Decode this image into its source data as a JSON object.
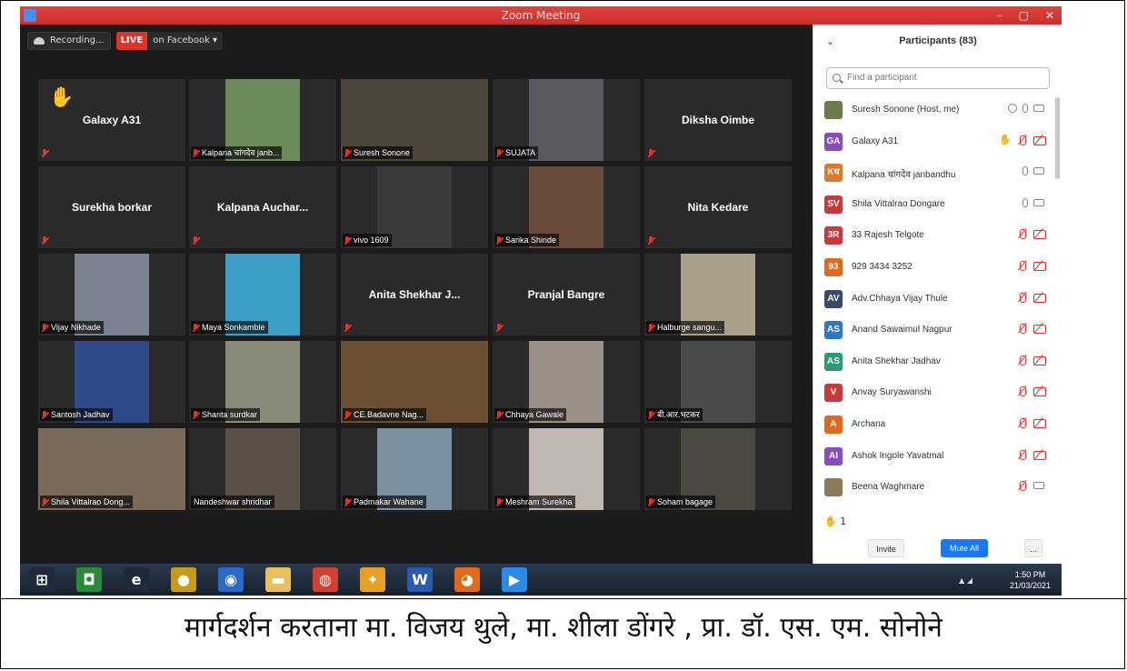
{
  "window": {
    "title": "Zoom Meeting",
    "controls": [
      "–",
      "▢",
      "✕"
    ]
  },
  "topbar": {
    "recording_label": "Recording...",
    "live_badge": "LIVE",
    "live_target": "on Facebook",
    "live_caret": "▾"
  },
  "tiles": [
    {
      "name": "Galaxy A31",
      "style": "center",
      "hand": true,
      "color": "#2a2a2a"
    },
    {
      "name": "Kalpana चांगदेव janb...",
      "style": "label",
      "color": "#6a8a5a"
    },
    {
      "name": "Suresh Sonone",
      "style": "label",
      "color": "#4b4438"
    },
    {
      "name": "SUJATA",
      "style": "label",
      "color": "#5a5a60"
    },
    {
      "name": "Diksha Oimbe",
      "style": "center",
      "color": "#2a2a2a"
    },
    {
      "name": "Surekha borkar",
      "style": "center",
      "color": "#2a2a2a"
    },
    {
      "name": "Kalpana  Auchar...",
      "style": "center",
      "color": "#2a2a2a"
    },
    {
      "name": "vivo 1609",
      "style": "label",
      "color": "#3d3a3a"
    },
    {
      "name": "Sarika Shinde",
      "style": "label",
      "color": "#6a4a3a"
    },
    {
      "name": "Nita Kedare",
      "style": "center",
      "color": "#2a2a2a"
    },
    {
      "name": "Vijay Nikhade",
      "style": "label",
      "color": "#7a8290"
    },
    {
      "name": "Maya Sonkamble",
      "style": "label",
      "color": "#3aa0c8"
    },
    {
      "name": "Anita Shekhar J...",
      "style": "center",
      "color": "#2a2a2a"
    },
    {
      "name": "Pranjal Bangre",
      "style": "center",
      "color": "#2a2a2a"
    },
    {
      "name": "Halburge sangu...",
      "style": "label",
      "color": "#a8a088"
    },
    {
      "name": "Santosh Jadhav",
      "style": "label",
      "color": "#2e4a8a"
    },
    {
      "name": "Shanta surdkar",
      "style": "label",
      "color": "#8a8a78"
    },
    {
      "name": "CE.Badavne Nag...",
      "style": "label",
      "color": "#6a5030"
    },
    {
      "name": "Chhaya Gawale",
      "style": "label",
      "color": "#9a9088"
    },
    {
      "name": "बी.आर.भटकर",
      "style": "label",
      "color": "#4a4a4a"
    },
    {
      "name": "Shila Vittalrao Dong...",
      "style": "label",
      "active": true,
      "color": "#7a6a5a"
    },
    {
      "name": "Nandeshwar shridhar",
      "style": "label",
      "nomic": true,
      "color": "#5a5048"
    },
    {
      "name": "Padmakar Wahane",
      "style": "label",
      "color": "#7a90a0"
    },
    {
      "name": "Meshram Surekha",
      "style": "label",
      "color": "#c0b8b0"
    },
    {
      "name": "Soham bagage",
      "style": "label",
      "color": "#4a4840"
    }
  ],
  "panel": {
    "collapse_icon": "⌄",
    "title": "Participants (83)",
    "search_placeholder": "Find a participant",
    "participants": [
      {
        "initials": "",
        "name": "Suresh Sonone (Host, me)",
        "color": "#6a7a4a",
        "icons": [
          "rec",
          "mic",
          "cam"
        ]
      },
      {
        "initials": "GA",
        "name": "Galaxy A31",
        "color": "#8a4ac0",
        "icons": [
          "hand",
          "micoff",
          "camoff"
        ]
      },
      {
        "initials": "Kच",
        "name": "Kalpana चांगदेव janbandhu",
        "color": "#e0782a",
        "icons": [
          "mic",
          "cam"
        ]
      },
      {
        "initials": "SV",
        "name": "Shila Vittalrao Dongare",
        "color": "#c83a3a",
        "icons": [
          "mic",
          "cam"
        ]
      },
      {
        "initials": "3R",
        "name": "33 Rajesh Telgote",
        "color": "#c83a3a",
        "icons": [
          "micoff",
          "camoff"
        ]
      },
      {
        "initials": "93",
        "name": "929 3434 3252",
        "color": "#e06a1a",
        "icons": [
          "micoff",
          "camoff"
        ]
      },
      {
        "initials": "AV",
        "name": "Adv.Chhaya  Vijay Thule",
        "color": "#3a4a6a",
        "icons": [
          "micoff",
          "camoff"
        ]
      },
      {
        "initials": "AS",
        "name": "Anand Sawaimul Nagpur",
        "color": "#2a7ac8",
        "icons": [
          "micoff",
          "camoff"
        ]
      },
      {
        "initials": "AS",
        "name": "Anita Shekhar Jadhav",
        "color": "#2a9a7a",
        "icons": [
          "micoff",
          "camoff"
        ]
      },
      {
        "initials": "V",
        "name": "Anvay Suryawanshi",
        "color": "#c83a3a",
        "icons": [
          "micoff",
          "camoff"
        ]
      },
      {
        "initials": "A",
        "name": "Archana",
        "color": "#e06a1a",
        "icons": [
          "micoff",
          "camoff"
        ]
      },
      {
        "initials": "AI",
        "name": "Ashok Ingole Yavatmal",
        "color": "#8a4ac0",
        "icons": [
          "micoff",
          "camoff"
        ]
      },
      {
        "initials": "",
        "name": "Beena Waghmare",
        "color": "#8a7a5a",
        "icons": [
          "micoff",
          "cam"
        ]
      }
    ],
    "raised_hands": "1",
    "invite_label": "Invite",
    "mute_all_label": "Mute All",
    "more_label": "..."
  },
  "taskbar": {
    "apps": [
      {
        "name": "windows-start",
        "glyph": "⊞",
        "color": "#1e2a3a"
      },
      {
        "name": "app-green",
        "glyph": "◘",
        "color": "#2a8a3a"
      },
      {
        "name": "internet-explorer",
        "glyph": "e",
        "color": "#1e2a3a"
      },
      {
        "name": "media-player",
        "glyph": "●",
        "color": "#c89a1a"
      },
      {
        "name": "chrome-alt",
        "glyph": "◉",
        "color": "#2a6ac8"
      },
      {
        "name": "file-explorer",
        "glyph": "▬",
        "color": "#e8c060"
      },
      {
        "name": "chrome",
        "glyph": "◍",
        "color": "#d04030"
      },
      {
        "name": "paint",
        "glyph": "✦",
        "color": "#e8a020"
      },
      {
        "name": "word",
        "glyph": "W",
        "color": "#2a5ab0"
      },
      {
        "name": "firefox",
        "glyph": "◕",
        "color": "#e06a1a"
      },
      {
        "name": "zoom",
        "glyph": "▶",
        "color": "#2a8ae8"
      }
    ],
    "time": "1:50 PM",
    "date": "21/03/2021"
  },
  "caption": "मार्गदर्शन करताना मा. विजय थुले, मा. शीला डोंगरे , प्रा. डॉ. एस. एम. सोनोने"
}
